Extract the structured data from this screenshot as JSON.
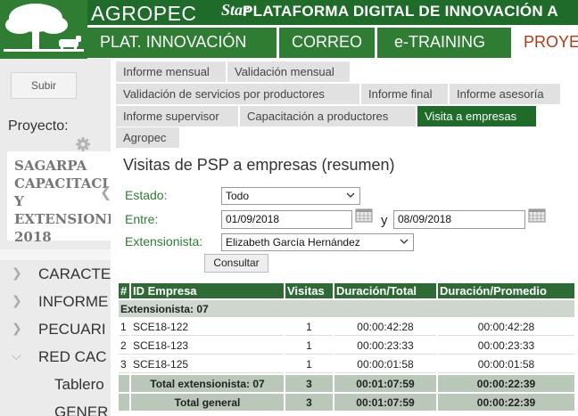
{
  "header": {
    "brand": "AGROPEC",
    "brand_suffix": "Star",
    "tagline": "PLATAFORMA DIGITAL DE INNOVACIÓN A",
    "nav": [
      {
        "label": "PLAT. INNOVACIÓN"
      },
      {
        "label": "CORREO"
      },
      {
        "label": "e-TRAINING"
      },
      {
        "label": "PROYE"
      }
    ],
    "colors": {
      "dark_green": "#1f6b2a",
      "green": "#2e7d32",
      "active_text": "#b13b17"
    }
  },
  "sidebar": {
    "upload_button": "Subir",
    "project_label": "Proyecto:",
    "project_name": "SAGARPA\nCAPACITACI\nY\nEXTENSIONI\n2018",
    "menu": [
      {
        "label": "CARACTE"
      },
      {
        "label": "INFORME"
      },
      {
        "label": "PECUARI"
      },
      {
        "label": "RED CAC"
      },
      {
        "label": "Tablero"
      },
      {
        "label": "GENER"
      }
    ]
  },
  "tabs": [
    {
      "label": "Informe mensual"
    },
    {
      "label": "Validación mensual"
    },
    {
      "label": "Validación de servicios por productores"
    },
    {
      "label": "Informe final"
    },
    {
      "label": "Informe asesoría"
    },
    {
      "label": "Informe supervisor"
    },
    {
      "label": "Capacitación a productores"
    },
    {
      "label": "Visita a empresas",
      "active": true
    },
    {
      "label": "Agropec"
    }
  ],
  "main": {
    "title": "Visitas de PSP a empresas (resumen)",
    "filters": {
      "estado_label": "Estado:",
      "estado_value": "Todo",
      "entre_label": "Entre:",
      "date_from": "01/09/2018",
      "conj": "y",
      "date_to": "08/09/2018",
      "ext_label": "Extensionista:",
      "ext_value": "Elizabeth García Hernández"
    },
    "submit": "Consultar"
  },
  "table": {
    "columns": [
      "#",
      "ID Empresa",
      "Visitas",
      "Duración/Total",
      "Duración/Promedio"
    ],
    "group_label": "Extensionista: 07",
    "rows": [
      {
        "n": "1",
        "id": "SCE18-122",
        "visitas": "1",
        "total": "00:00:42:28",
        "promedio": "00:00:42:28"
      },
      {
        "n": "2",
        "id": "SCE18-123",
        "visitas": "1",
        "total": "00:00:23:33",
        "promedio": "00:00:23:33"
      },
      {
        "n": "3",
        "id": "SCE18-125",
        "visitas": "1",
        "total": "00:00:01:58",
        "promedio": "00:00:01:58"
      }
    ],
    "subtotal": {
      "label": "Total extensionista: 07",
      "visitas": "3",
      "total": "00:01:07:59",
      "promedio": "00:00:22:39"
    },
    "grandtotal": {
      "label": "Total general",
      "visitas": "3",
      "total": "00:01:07:59",
      "promedio": "00:00:22:39"
    }
  }
}
